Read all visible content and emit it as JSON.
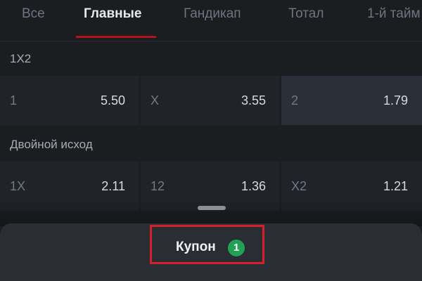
{
  "tabs": [
    {
      "label": "Все"
    },
    {
      "label": "Главные"
    },
    {
      "label": "Гандикап"
    },
    {
      "label": "Тотал"
    },
    {
      "label": "1-й тайм"
    }
  ],
  "active_tab": "Главные",
  "markets": [
    {
      "title": "1X2",
      "outcomes": [
        {
          "name": "1",
          "odds": "5.50"
        },
        {
          "name": "X",
          "odds": "3.55"
        },
        {
          "name": "2",
          "odds": "1.79",
          "selected": true
        }
      ]
    },
    {
      "title": "Двойной исход",
      "outcomes": [
        {
          "name": "1X",
          "odds": "2.11"
        },
        {
          "name": "12",
          "odds": "1.36"
        },
        {
          "name": "X2",
          "odds": "1.21"
        }
      ]
    }
  ],
  "coupon": {
    "label": "Купон",
    "count": "1"
  },
  "colors": {
    "background": "#1b1d21",
    "accent_red": "#b5141c",
    "highlight_box": "#d4202a",
    "badge_green": "#22a053",
    "selected_cell": "#2b2f37"
  }
}
